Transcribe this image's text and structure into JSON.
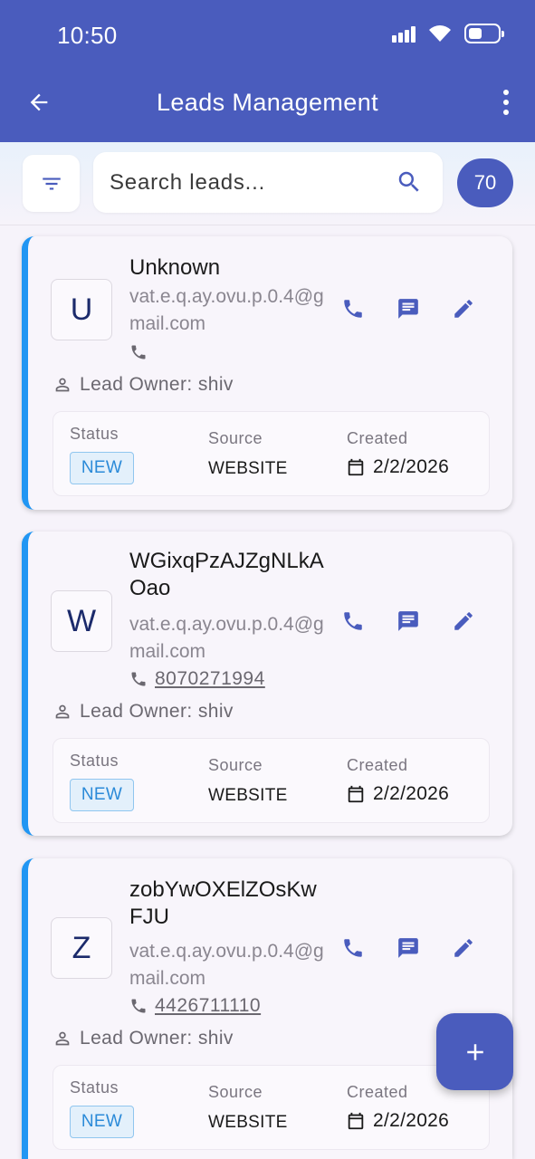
{
  "status_bar": {
    "time": "10:50"
  },
  "app_bar": {
    "title": "Leads Management"
  },
  "search": {
    "placeholder": "Search leads...",
    "value": ""
  },
  "lead_count": "70",
  "colors": {
    "primary": "#4a5cbd",
    "card_accent": "#2196f3",
    "badge_text": "#2b8ad8"
  },
  "labels": {
    "owner_prefix": "Lead Owner: ",
    "status": "Status",
    "source": "Source",
    "created": "Created"
  },
  "leads": [
    {
      "initial": "U",
      "name": "Unknown",
      "email": "vat.e.q.ay.ovu.p.0.4@gmail.com",
      "phone": "",
      "owner": "Lead Owner: shiv",
      "status": "NEW",
      "source": "WEBSITE",
      "created": "2/2/2026"
    },
    {
      "initial": "W",
      "name": "WGixqPzAJZgNLkAOao",
      "email": "vat.e.q.ay.ovu.p.0.4@gmail.com",
      "phone": "8070271994",
      "owner": "Lead Owner: shiv",
      "status": "NEW",
      "source": "WEBSITE",
      "created": "2/2/2026"
    },
    {
      "initial": "Z",
      "name": "zobYwOXElZOsKwFJU",
      "email": "vat.e.q.ay.ovu.p.0.4@gmail.com",
      "phone": "4426711110",
      "owner": "Lead Owner: shiv",
      "status": "NEW",
      "source": "WEBSITE",
      "created": "2/2/2026"
    }
  ],
  "icons": [
    "back-arrow-icon",
    "more-vert-icon",
    "filter-icon",
    "search-icon",
    "phone-icon",
    "message-icon",
    "edit-icon",
    "person-icon",
    "calendar-icon",
    "add-icon"
  ]
}
